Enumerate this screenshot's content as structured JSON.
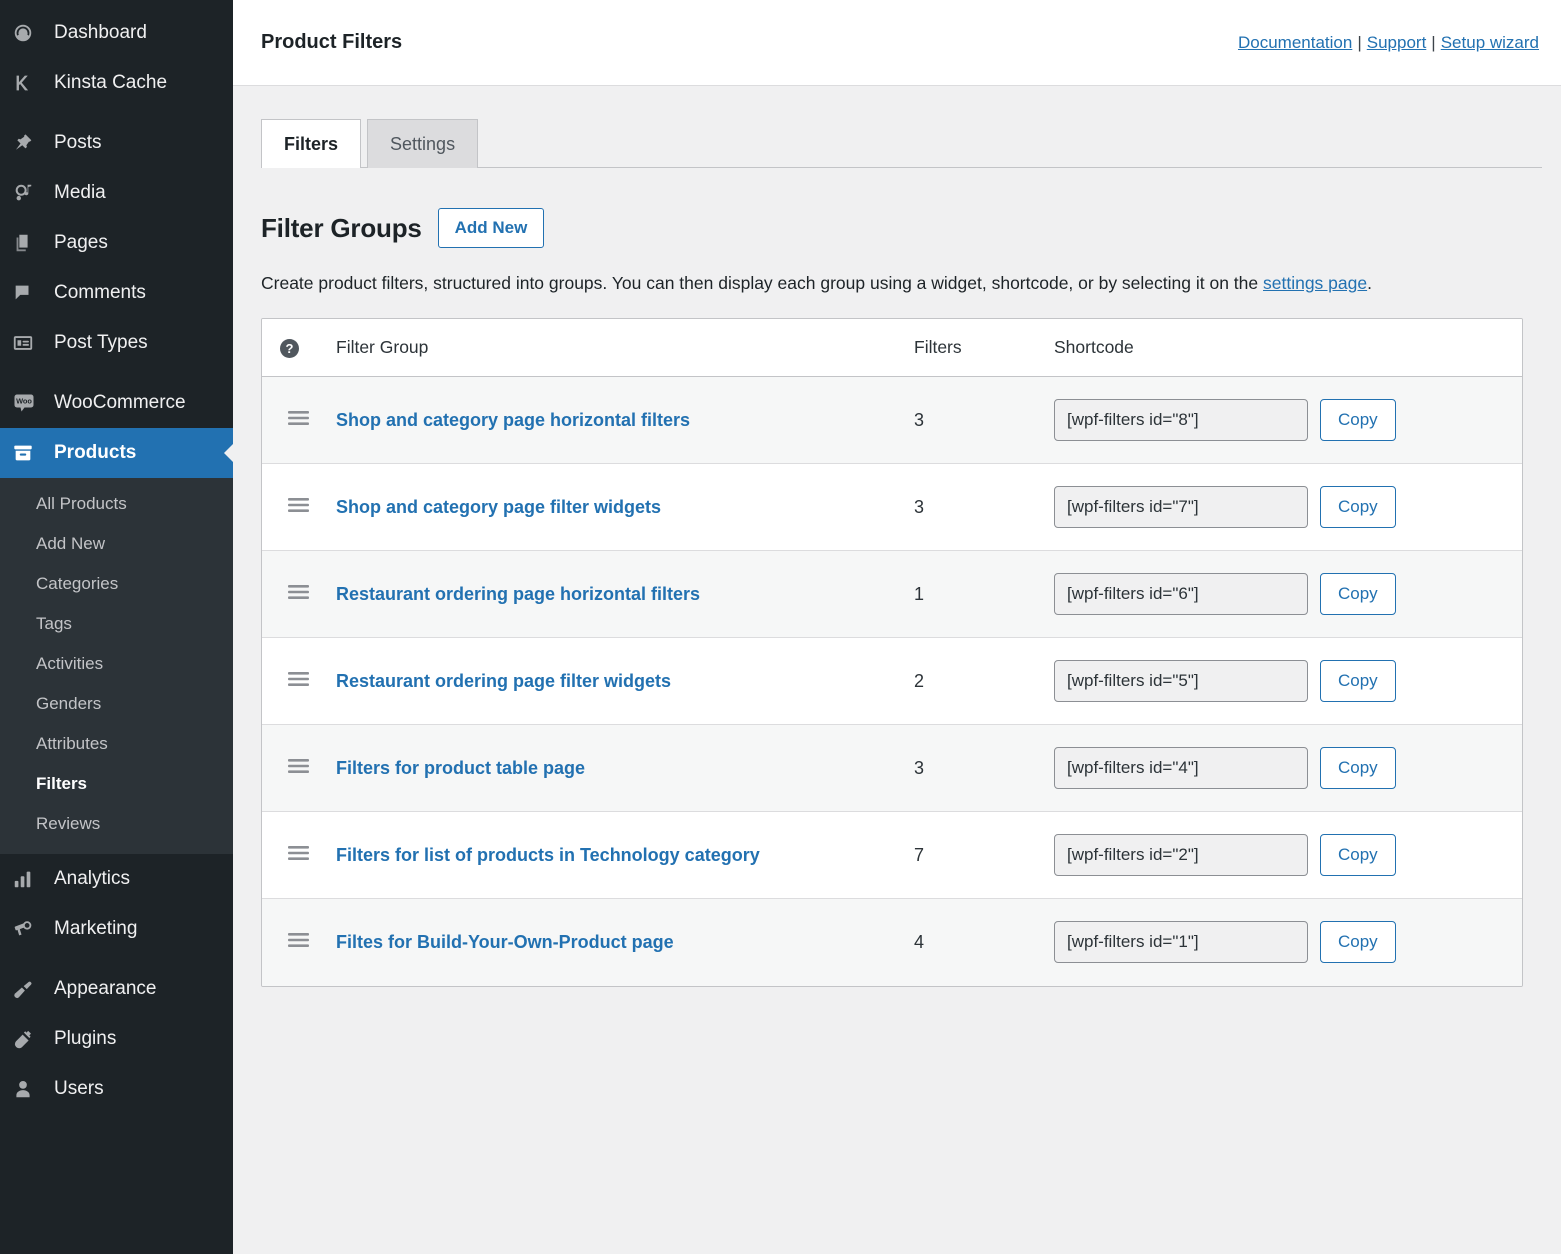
{
  "sidebar": {
    "items": [
      {
        "label": "Dashboard",
        "icon": "dashboard-icon",
        "active": false
      },
      {
        "label": "Kinsta Cache",
        "icon": "kinsta-icon",
        "active": false
      },
      {
        "label": "Posts",
        "icon": "pin-icon",
        "active": false
      },
      {
        "label": "Media",
        "icon": "media-icon",
        "active": false
      },
      {
        "label": "Pages",
        "icon": "pages-icon",
        "active": false
      },
      {
        "label": "Comments",
        "icon": "comments-icon",
        "active": false
      },
      {
        "label": "Post Types",
        "icon": "post-types-icon",
        "active": false
      },
      {
        "label": "WooCommerce",
        "icon": "woocommerce-icon",
        "active": false
      },
      {
        "label": "Products",
        "icon": "products-icon",
        "active": true
      },
      {
        "label": "Analytics",
        "icon": "analytics-icon",
        "active": false
      },
      {
        "label": "Marketing",
        "icon": "megaphone-icon",
        "active": false
      },
      {
        "label": "Appearance",
        "icon": "paintbrush-icon",
        "active": false
      },
      {
        "label": "Plugins",
        "icon": "plug-icon",
        "active": false
      },
      {
        "label": "Users",
        "icon": "user-icon",
        "active": false
      }
    ],
    "submenu": [
      {
        "label": "All Products",
        "current": false
      },
      {
        "label": "Add New",
        "current": false
      },
      {
        "label": "Categories",
        "current": false
      },
      {
        "label": "Tags",
        "current": false
      },
      {
        "label": "Activities",
        "current": false
      },
      {
        "label": "Genders",
        "current": false
      },
      {
        "label": "Attributes",
        "current": false
      },
      {
        "label": "Filters",
        "current": true
      },
      {
        "label": "Reviews",
        "current": false
      }
    ]
  },
  "header": {
    "title": "Product Filters",
    "links": [
      {
        "label": "Documentation"
      },
      {
        "label": "Support"
      },
      {
        "label": "Setup wizard"
      }
    ],
    "link_separator": "|"
  },
  "tabs": [
    {
      "label": "Filters",
      "active": true
    },
    {
      "label": "Settings",
      "active": false
    }
  ],
  "filter_groups_section": {
    "heading": "Filter Groups",
    "add_new_label": "Add New",
    "description_part1": "Create product filters, structured into groups. You can then display each group using a widget, shortcode, or by selecting it on the ",
    "description_link": "settings page",
    "description_part2": "."
  },
  "table": {
    "help_icon_glyph": "?",
    "columns": {
      "handle": "",
      "name": "Filter Group",
      "filters": "Filters",
      "shortcode": "Shortcode"
    },
    "copy_label": "Copy",
    "rows": [
      {
        "name": "Shop and category page horizontal filters",
        "filters": "3",
        "shortcode": "[wpf-filters id=\"8\"]"
      },
      {
        "name": "Shop and category page filter widgets",
        "filters": "3",
        "shortcode": "[wpf-filters id=\"7\"]"
      },
      {
        "name": "Restaurant ordering page horizontal filters",
        "filters": "1",
        "shortcode": "[wpf-filters id=\"6\"]"
      },
      {
        "name": "Restaurant ordering page filter widgets",
        "filters": "2",
        "shortcode": "[wpf-filters id=\"5\"]"
      },
      {
        "name": "Filters for product table page",
        "filters": "3",
        "shortcode": "[wpf-filters id=\"4\"]"
      },
      {
        "name": "Filters for list of products in Technology category",
        "filters": "7",
        "shortcode": "[wpf-filters id=\"2\"]"
      },
      {
        "name": "Filtes for Build-Your-Own-Product page",
        "filters": "4",
        "shortcode": "[wpf-filters id=\"1\"]"
      }
    ]
  },
  "colors": {
    "sidebar_bg": "#1d2327",
    "submenu_bg": "#2c3338",
    "accent_blue": "#2271b1",
    "page_bg": "#f0f0f1",
    "row_stripe": "#f6f7f7"
  }
}
